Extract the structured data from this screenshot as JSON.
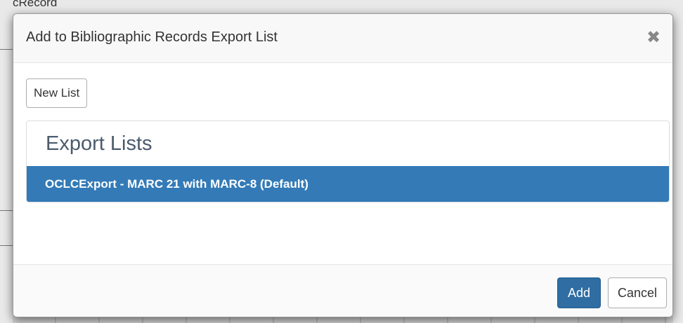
{
  "background": {
    "partial_text": "cRecord"
  },
  "modal": {
    "title": "Add to Bibliographic Records Export List",
    "close_icon": "close-icon",
    "new_list_label": "New List",
    "panel": {
      "heading": "Export Lists",
      "items": [
        {
          "label": "OCLCExport - MARC 21 with MARC-8 (Default)",
          "selected": true
        }
      ]
    },
    "footer": {
      "add_label": "Add",
      "cancel_label": "Cancel"
    }
  },
  "colors": {
    "accent": "#337ab7",
    "primary_button": "#2f6da3"
  }
}
